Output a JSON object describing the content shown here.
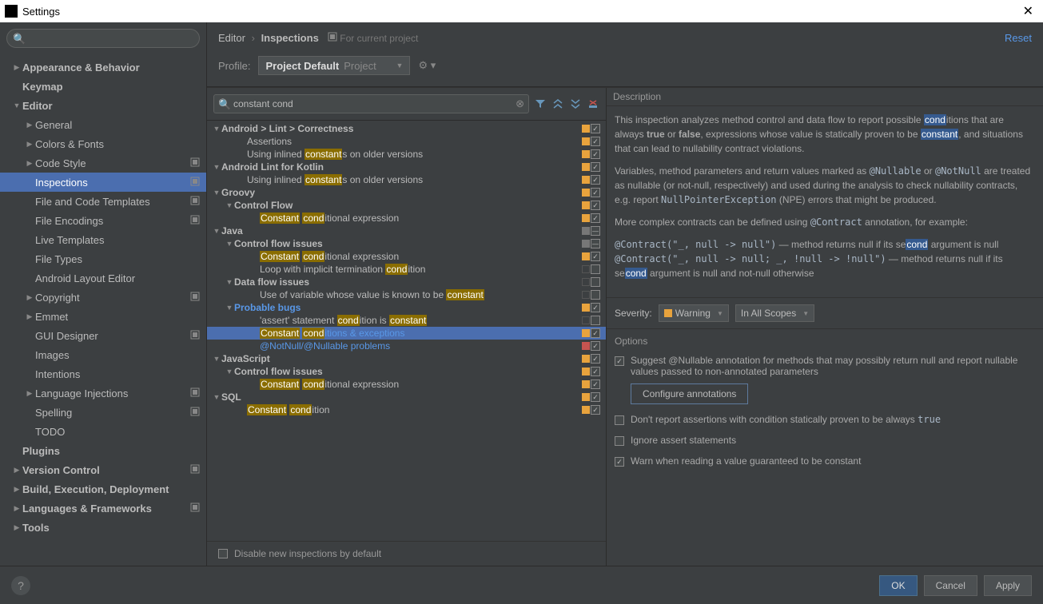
{
  "window": {
    "title": "Settings"
  },
  "breadcrumb": {
    "p1": "Editor",
    "p2": "Inspections",
    "suffix": "For current project",
    "reset": "Reset"
  },
  "profile": {
    "label": "Profile:",
    "name": "Project Default",
    "scope": "Project"
  },
  "sidebar_search": {
    "placeholder": ""
  },
  "sidebar": [
    {
      "label": "Appearance & Behavior",
      "bold": true,
      "indent": 0,
      "arrow": "▶",
      "proj": false
    },
    {
      "label": "Keymap",
      "bold": true,
      "indent": 0,
      "arrow": "",
      "proj": false
    },
    {
      "label": "Editor",
      "bold": true,
      "indent": 0,
      "arrow": "▼",
      "proj": false
    },
    {
      "label": "General",
      "bold": false,
      "indent": 1,
      "arrow": "▶",
      "proj": false
    },
    {
      "label": "Colors & Fonts",
      "bold": false,
      "indent": 1,
      "arrow": "▶",
      "proj": false
    },
    {
      "label": "Code Style",
      "bold": false,
      "indent": 1,
      "arrow": "▶",
      "proj": true
    },
    {
      "label": "Inspections",
      "bold": false,
      "indent": 1,
      "arrow": "",
      "proj": true,
      "selected": true
    },
    {
      "label": "File and Code Templates",
      "bold": false,
      "indent": 1,
      "arrow": "",
      "proj": true
    },
    {
      "label": "File Encodings",
      "bold": false,
      "indent": 1,
      "arrow": "",
      "proj": true
    },
    {
      "label": "Live Templates",
      "bold": false,
      "indent": 1,
      "arrow": "",
      "proj": false
    },
    {
      "label": "File Types",
      "bold": false,
      "indent": 1,
      "arrow": "",
      "proj": false
    },
    {
      "label": "Android Layout Editor",
      "bold": false,
      "indent": 1,
      "arrow": "",
      "proj": false
    },
    {
      "label": "Copyright",
      "bold": false,
      "indent": 1,
      "arrow": "▶",
      "proj": true
    },
    {
      "label": "Emmet",
      "bold": false,
      "indent": 1,
      "arrow": "▶",
      "proj": false
    },
    {
      "label": "GUI Designer",
      "bold": false,
      "indent": 1,
      "arrow": "",
      "proj": true
    },
    {
      "label": "Images",
      "bold": false,
      "indent": 1,
      "arrow": "",
      "proj": false
    },
    {
      "label": "Intentions",
      "bold": false,
      "indent": 1,
      "arrow": "",
      "proj": false
    },
    {
      "label": "Language Injections",
      "bold": false,
      "indent": 1,
      "arrow": "▶",
      "proj": true
    },
    {
      "label": "Spelling",
      "bold": false,
      "indent": 1,
      "arrow": "",
      "proj": true
    },
    {
      "label": "TODO",
      "bold": false,
      "indent": 1,
      "arrow": "",
      "proj": false
    },
    {
      "label": "Plugins",
      "bold": true,
      "indent": 0,
      "arrow": "",
      "proj": false
    },
    {
      "label": "Version Control",
      "bold": true,
      "indent": 0,
      "arrow": "▶",
      "proj": true
    },
    {
      "label": "Build, Execution, Deployment",
      "bold": true,
      "indent": 0,
      "arrow": "▶",
      "proj": false
    },
    {
      "label": "Languages & Frameworks",
      "bold": true,
      "indent": 0,
      "arrow": "▶",
      "proj": true
    },
    {
      "label": "Tools",
      "bold": true,
      "indent": 0,
      "arrow": "▶",
      "proj": false
    }
  ],
  "insp_search": {
    "value": "constant cond"
  },
  "insp_tree": [
    {
      "indent": 0,
      "arrow": "▼",
      "bold": true,
      "html": "Android > Lint > Correctness",
      "sev": "warning",
      "check": "checked"
    },
    {
      "indent": 2,
      "arrow": "",
      "html": "Assertions",
      "sev": "warning",
      "check": "checked"
    },
    {
      "indent": 2,
      "arrow": "",
      "html": "Using inlined <span class='hl'>constant</span>s on older versions",
      "sev": "warning",
      "check": "checked"
    },
    {
      "indent": 0,
      "arrow": "▼",
      "bold": true,
      "html": "Android Lint for Kotlin",
      "sev": "warning",
      "check": "checked"
    },
    {
      "indent": 2,
      "arrow": "",
      "html": "Using inlined <span class='hl'>constant</span>s on older versions",
      "sev": "warning",
      "check": "checked"
    },
    {
      "indent": 0,
      "arrow": "▼",
      "bold": true,
      "html": "Groovy",
      "sev": "warning",
      "check": "checked"
    },
    {
      "indent": 1,
      "arrow": "▼",
      "bold": true,
      "html": "Control Flow",
      "sev": "warning",
      "check": "checked"
    },
    {
      "indent": 3,
      "arrow": "",
      "html": "<span class='hl'>Constant</span> <span class='hl'>cond</span>itional expression",
      "sev": "warning",
      "check": "checked"
    },
    {
      "indent": 0,
      "arrow": "▼",
      "bold": true,
      "html": "Java",
      "sev": "neutral",
      "check": "indet"
    },
    {
      "indent": 1,
      "arrow": "▼",
      "bold": true,
      "html": "Control flow issues",
      "sev": "neutral",
      "check": "indet"
    },
    {
      "indent": 3,
      "arrow": "",
      "html": "<span class='hl'>Constant</span> <span class='hl'>cond</span>itional expression",
      "sev": "warning",
      "check": "checked"
    },
    {
      "indent": 3,
      "arrow": "",
      "html": "Loop with implicit termination <span class='hl'>cond</span>ition",
      "sev": "none",
      "check": ""
    },
    {
      "indent": 1,
      "arrow": "▼",
      "bold": true,
      "html": "Data flow issues",
      "sev": "none",
      "check": ""
    },
    {
      "indent": 3,
      "arrow": "",
      "html": "Use of variable whose value is known to be <span class='hl'>constant</span>",
      "sev": "none",
      "check": ""
    },
    {
      "indent": 1,
      "arrow": "▼",
      "bold": true,
      "html": "Probable bugs",
      "sev": "warning",
      "check": "checked",
      "link": true
    },
    {
      "indent": 3,
      "arrow": "",
      "html": "'assert' statement <span class='hl'>cond</span>ition is <span class='hl'>constant</span>",
      "sev": "none",
      "check": ""
    },
    {
      "indent": 3,
      "arrow": "",
      "html": "<span class='hl'>Constant</span> <span class='hl'>cond</span>itions & exceptions",
      "sev": "warning",
      "check": "checked",
      "selected": true,
      "link": true
    },
    {
      "indent": 3,
      "arrow": "",
      "html": "@NotNull/@Nullable problems",
      "sev": "error",
      "check": "checked",
      "link": true
    },
    {
      "indent": 0,
      "arrow": "▼",
      "bold": true,
      "html": "JavaScript",
      "sev": "warning",
      "check": "checked"
    },
    {
      "indent": 1,
      "arrow": "▼",
      "bold": true,
      "html": "Control flow issues",
      "sev": "warning",
      "check": "checked"
    },
    {
      "indent": 3,
      "arrow": "",
      "html": "<span class='hl'>Constant</span> <span class='hl'>cond</span>itional expression",
      "sev": "warning",
      "check": "checked"
    },
    {
      "indent": 0,
      "arrow": "▼",
      "bold": true,
      "html": "SQL",
      "sev": "warning",
      "check": "checked"
    },
    {
      "indent": 2,
      "arrow": "",
      "html": "<span class='hl'>Constant</span> <span class='hl'>cond</span>ition",
      "sev": "warning",
      "check": "checked"
    }
  ],
  "desc": {
    "header": "Description",
    "p1_a": "This inspection analyzes method control and data flow to report possible ",
    "p1_hl1": "cond",
    "p1_b": "itions that are always ",
    "p1_true": "true",
    "p1_c": " or ",
    "p1_false": "false",
    "p1_d": ", expressions whose value is statically proven to be ",
    "p1_hl2": "constant",
    "p1_e": ", and situations that can lead to nullability contract violations.",
    "p2_a": "Variables, method parameters and return values marked as ",
    "p2_n1": "@Nullable",
    "p2_b": " or ",
    "p2_n2": "@NotNull",
    "p2_c": " are treated as nullable (or not-null, respectively) and used during the analysis to check nullability contracts, e.g. report ",
    "p2_npe": "NullPointerException",
    "p2_d": " (NPE) errors that might be produced.",
    "p3_a": "More complex contracts can be defined using ",
    "p3_c": "@Contract",
    "p3_b": " annotation, for example:",
    "p4_c1": "@Contract(\"_, null -> null\")",
    "p4_a": " — method returns null if its se",
    "p4_hl": "cond",
    "p4_b": " argument is null",
    "p5_c1": "@Contract(\"_, null -> null; _, !null -> !null\")",
    "p5_a": " — method returns null if its se",
    "p5_hl": "cond",
    "p5_b": " argument is null and not-null otherwise"
  },
  "severity": {
    "label": "Severity:",
    "value": "Warning",
    "scope": "In All Scopes"
  },
  "options": {
    "header": "Options",
    "opt1": "Suggest @Nullable annotation for methods that may possibly return null and report nullable values passed to non-annotated parameters",
    "configure": "Configure annotations",
    "opt2_a": "Don't report assertions with condition statically proven to be always ",
    "opt2_b": "true",
    "opt3": "Ignore assert statements",
    "opt4": "Warn when reading a value guaranteed to be constant"
  },
  "disable": {
    "label": "Disable new inspections by default"
  },
  "footer": {
    "ok": "OK",
    "cancel": "Cancel",
    "apply": "Apply"
  }
}
